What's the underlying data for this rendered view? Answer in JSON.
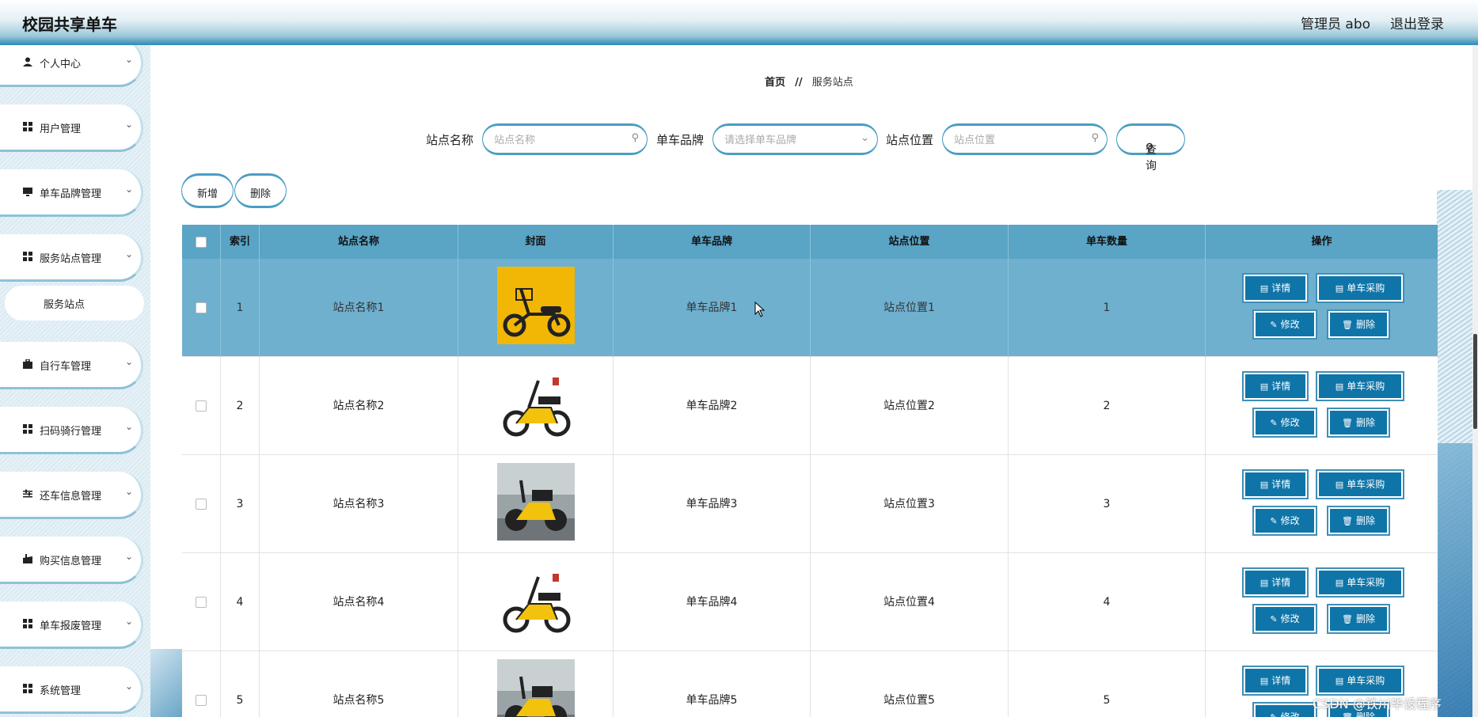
{
  "header": {
    "title": "校园共享单车",
    "admin_label": "管理员 abo",
    "logout_label": "退出登录"
  },
  "sidebar": {
    "items": [
      {
        "label": "个人中心",
        "icon": "user-icon"
      },
      {
        "label": "用户管理",
        "icon": "grid-icon"
      },
      {
        "label": "单车品牌管理",
        "icon": "monitor-icon"
      },
      {
        "label": "服务站点管理",
        "icon": "grid-icon"
      },
      {
        "label": "自行车管理",
        "icon": "briefcase-icon"
      },
      {
        "label": "扫码骑行管理",
        "icon": "grid-icon"
      },
      {
        "label": "还车信息管理",
        "icon": "sliders-icon"
      },
      {
        "label": "购买信息管理",
        "icon": "shopping-icon"
      },
      {
        "label": "单车报废管理",
        "icon": "grid-icon"
      },
      {
        "label": "系统管理",
        "icon": "grid-icon"
      }
    ],
    "sub_item": "服务站点"
  },
  "breadcrumb": {
    "home": "首页",
    "separator": "//",
    "current": "服务站点"
  },
  "search": {
    "station_name_label": "站点名称",
    "station_name_placeholder": "站点名称",
    "brand_label": "单车品牌",
    "brand_placeholder": "请选择单车品牌",
    "location_label": "站点位置",
    "location_placeholder": "站点位置",
    "query_label": "查询"
  },
  "actions": {
    "add_label": "新增",
    "delete_label": "删除"
  },
  "table": {
    "columns": [
      "索引",
      "站点名称",
      "封面",
      "单车品牌",
      "站点位置",
      "单车数量",
      "操作"
    ],
    "rows": [
      {
        "index": "1",
        "name": "站点名称1",
        "brand": "单车品牌1",
        "location": "站点位置1",
        "count": "1",
        "cover": "yellow-scooter"
      },
      {
        "index": "2",
        "name": "站点名称2",
        "brand": "单车品牌2",
        "location": "站点位置2",
        "count": "2",
        "cover": "yellow-ebike"
      },
      {
        "index": "3",
        "name": "站点名称3",
        "brand": "单车品牌3",
        "location": "站点位置3",
        "count": "3",
        "cover": "ebike-photo"
      },
      {
        "index": "4",
        "name": "站点名称4",
        "brand": "单车品牌4",
        "location": "站点位置4",
        "count": "4",
        "cover": "yellow-ebike"
      },
      {
        "index": "5",
        "name": "站点名称5",
        "brand": "单车品牌5",
        "location": "站点位置5",
        "count": "5",
        "cover": "ebike-photo"
      }
    ],
    "op_labels": {
      "detail": "详情",
      "purchase": "单车采购",
      "edit": "修改",
      "delete": "删除"
    }
  },
  "watermark": "CSDN @铁川毕设程序",
  "colors": {
    "accent": "#0f75a8",
    "header_bg": "#5aa4c5",
    "active_row": "#6fb0cf",
    "border_accent": "#4b9dc3"
  }
}
